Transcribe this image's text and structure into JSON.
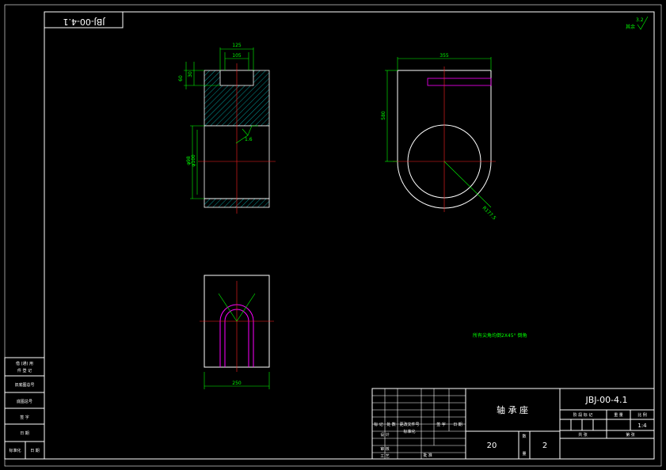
{
  "drawing": {
    "number": "JBJ-00-4.1",
    "number_mirrored": "JBJ-00-4.1",
    "part_name": "轴 承 座",
    "note": "所有尖角均倒2X45° 倒角",
    "scale": "1:4",
    "quantity_cell": "20",
    "sheet_cell": "2",
    "surface_finish": "其余",
    "surface_value": "3.2"
  },
  "dimensions": {
    "top_width": "125",
    "slot_width": "105",
    "height_total": "60",
    "slot_depth": "30",
    "bore_dia": "φ98",
    "bore_dia_2": "φ100",
    "roughness": "1.6",
    "side_width": "355",
    "side_height": "580",
    "radius": "R177.5",
    "bottom_width": "250"
  },
  "title_block": {
    "role_rows": [
      "标 记",
      "设 计",
      "审 核",
      "工 艺"
    ],
    "header_cells": [
      "标 记",
      "处 数",
      "更改文件号",
      "签 字",
      "日 期"
    ],
    "row2_cells": [
      "标准化",
      "批 准"
    ],
    "stage_headers": [
      "阶 段 标 记",
      "重 量",
      "比 例"
    ],
    "sheet_labels": [
      "共 张",
      "第 张"
    ],
    "qty_label": "数",
    "qty_label2": "量"
  },
  "left_strip": {
    "cells": [
      "借 (通) 用",
      "件 登 记",
      "旧底图总号",
      "底图总号",
      "签 字",
      "日 期",
      "标准化",
      "日 期"
    ]
  }
}
